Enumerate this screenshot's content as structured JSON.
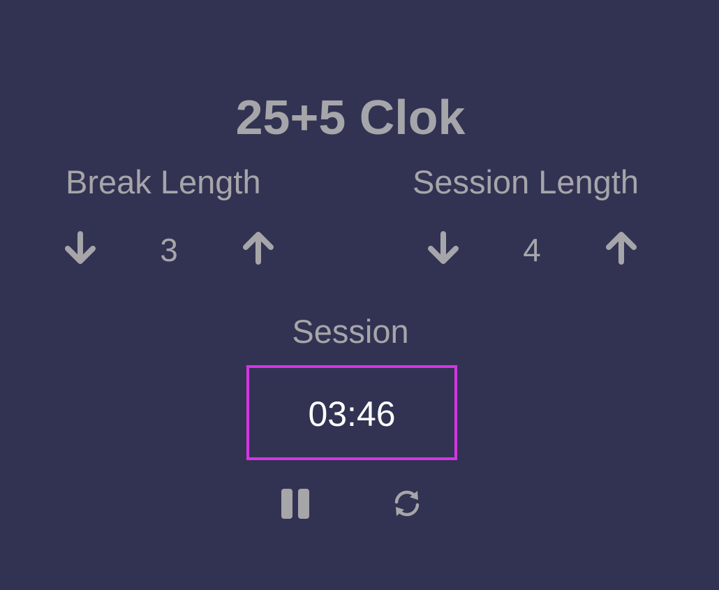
{
  "app": {
    "title": "25+5 Clok"
  },
  "break": {
    "label": "Break Length",
    "value": "3",
    "decrement_icon": "arrow-down-icon",
    "increment_icon": "arrow-up-icon"
  },
  "session": {
    "label": "Session Length",
    "value": "4",
    "decrement_icon": "arrow-down-icon",
    "increment_icon": "arrow-up-icon"
  },
  "timer": {
    "label": "Session",
    "time_left": "03:46",
    "border_color": "#d535e3"
  },
  "controls": {
    "play_pause_icon": "pause-icon",
    "reset_icon": "refresh-icon"
  },
  "colors": {
    "background": "#323353",
    "text": "#a6a6aa",
    "time_text": "#ffffff",
    "accent": "#d535e3"
  }
}
